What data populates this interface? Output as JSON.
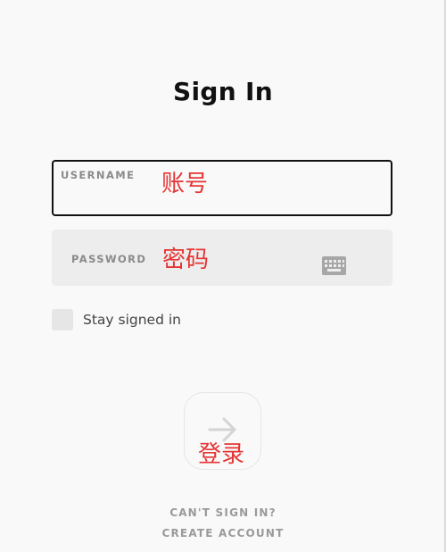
{
  "title": "Sign In",
  "username": {
    "label": "USERNAME",
    "value": "",
    "annotation": "账号"
  },
  "password": {
    "label": "PASSWORD",
    "value": "",
    "annotation": "密码",
    "keyboard_icon": "keyboard-icon"
  },
  "stay_signed_in": {
    "label": "Stay signed in",
    "checked": false
  },
  "submit": {
    "icon": "arrow-right-icon",
    "annotation": "登录"
  },
  "links": {
    "cant_sign_in": "CAN'T SIGN IN?",
    "create_account": "CREATE ACCOUNT"
  },
  "colors": {
    "background": "#f9f9f9",
    "field_active_border": "#111111",
    "field_inactive_bg": "#ededed",
    "annotation": "#e53535",
    "muted_text": "#9a9a9a"
  }
}
